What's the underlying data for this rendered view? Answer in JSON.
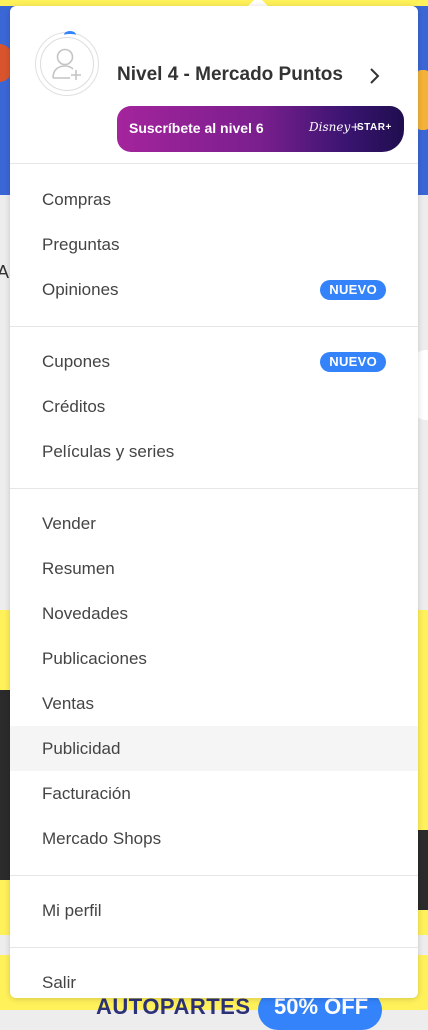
{
  "profile": {
    "level_title": "Nivel 4 - Mercado Puntos",
    "subscribe_text": "Suscríbete al nivel 6",
    "brand_logos": {
      "disney": "Disney+",
      "star": "STAR+"
    }
  },
  "sections": [
    {
      "items": [
        {
          "label": "Compras"
        },
        {
          "label": "Preguntas"
        },
        {
          "label": "Opiniones",
          "badge": "NUEVO"
        }
      ]
    },
    {
      "items": [
        {
          "label": "Cupones",
          "badge": "NUEVO"
        },
        {
          "label": "Créditos"
        },
        {
          "label": "Películas y series"
        }
      ]
    },
    {
      "items": [
        {
          "label": "Vender"
        },
        {
          "label": "Resumen"
        },
        {
          "label": "Novedades"
        },
        {
          "label": "Publicaciones"
        },
        {
          "label": "Ventas"
        },
        {
          "label": "Publicidad"
        },
        {
          "label": "Facturación"
        },
        {
          "label": "Mercado Shops"
        }
      ]
    },
    {
      "items": [
        {
          "label": "Mi perfil"
        }
      ]
    },
    {
      "items": [
        {
          "label": "Salir"
        }
      ]
    }
  ],
  "background": {
    "partial_letter": "A",
    "promo_text": "AUTOPARTES",
    "promo_badge": "50% OFF"
  },
  "colors": {
    "accent": "#3483fa",
    "brand_yellow": "#fff159",
    "banner_start": "#a4249c",
    "banner_end": "#1f0e4f"
  }
}
